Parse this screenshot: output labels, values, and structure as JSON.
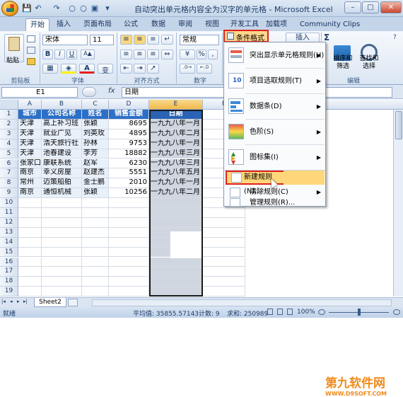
{
  "window": {
    "title": "自动突出单元格内容全为汉字的单元格 - Microsoft Excel"
  },
  "quick_access": {
    "save": "💾",
    "undo": "↶",
    "redo": "↷",
    "circle1": "○",
    "circle2": "○",
    "print": "▣",
    "more": "▾"
  },
  "window_controls": {
    "minimize": "–",
    "maximize": "□",
    "close": "✕"
  },
  "tabs": [
    "开始",
    "插入",
    "页面布局",
    "公式",
    "数据",
    "审阅",
    "视图",
    "开发工具",
    "加载项",
    "Community Clips"
  ],
  "ribbon": {
    "paste_label": "粘贴",
    "clipboard_group": "剪贴板",
    "font_name": "宋体",
    "font_size": "11",
    "font_group": "字体",
    "bold": "B",
    "italic": "I",
    "underline": "U",
    "font_color_letter": "A",
    "wen": "变",
    "align_group": "对齐方式",
    "number_format": "常规",
    "percent": "%",
    "comma": ",",
    "number_group": "数字",
    "conditional_format": "条件格式",
    "insert_label": "插入",
    "sigma": "Σ",
    "sort_filter": "排序和\n筛选",
    "find_select": "查找和\n选择",
    "edit_group": "编辑"
  },
  "formula_bar": {
    "name_box": "E1",
    "fx": "fx",
    "content": "日期"
  },
  "columns": [
    "A",
    "B",
    "C",
    "D",
    "E",
    "F"
  ],
  "rows": [
    "1",
    "2",
    "3",
    "4",
    "5",
    "6",
    "7",
    "8",
    "9",
    "10",
    "11",
    "12",
    "13",
    "14",
    "15",
    "16",
    "17",
    "18",
    "19"
  ],
  "table": {
    "headers": [
      "城市",
      "公司名称",
      "姓名",
      "销售金额",
      "日期"
    ],
    "rows": [
      [
        "天津",
        "高上补习班",
        "张颖",
        "8695",
        "一九九八年一月"
      ],
      [
        "天津",
        "就业广见",
        "刘英玫",
        "4895",
        "一九九八年二月"
      ],
      [
        "天津",
        "浩天旅行社",
        "孙林",
        "9753",
        "一九九八年一月"
      ],
      [
        "天津",
        "池春建设",
        "李芳",
        "18882",
        "一九九八年三月"
      ],
      [
        "张家口",
        "康联系统",
        "赵军",
        "6230",
        "一九九八年三月"
      ],
      [
        "南京",
        "幸义房屋",
        "赵建杰",
        "5551",
        "一九九八年五月"
      ],
      [
        "常州",
        "迈策船舶",
        "金士鹏",
        "2010",
        "一九九八年一月"
      ],
      [
        "南京",
        "通恒机械",
        "张颖",
        "10256",
        "一九九八年二月"
      ]
    ]
  },
  "cf_menu": {
    "items": [
      {
        "label": "突出显示单元格规则(H)",
        "icon": "highlight-rules-icon"
      },
      {
        "label": "项目选取规则(T)",
        "icon": "top-bottom-rules-icon"
      },
      {
        "label": "数据条(D)",
        "icon": "data-bars-icon"
      },
      {
        "label": "色阶(S)",
        "icon": "color-scales-icon"
      },
      {
        "label": "图标集(I)",
        "icon": "icon-sets-icon"
      }
    ],
    "small_items": [
      {
        "label": "新建规则(N)...",
        "icon": "new-rule-icon"
      },
      {
        "label": "清除规则(C)",
        "icon": "clear-rules-icon"
      },
      {
        "label": "管理规则(R)...",
        "icon": "manage-rules-icon"
      }
    ],
    "submenu_arrow": "▶",
    "top10_text": "10"
  },
  "sheet": {
    "tab": "Sheet2",
    "nav": [
      "|◂",
      "◂",
      "▸",
      "▸|"
    ]
  },
  "status": {
    "mode": "就绪",
    "average": "平均值: 35855.57143",
    "count": "计数: 9",
    "sum": "求和: 250989",
    "zoom": "100%"
  },
  "watermark": {
    "main": "第九软件网",
    "sub": "WWW.D9SOFT.COM"
  },
  "colors": {
    "header_blue": "#2c6fc7",
    "highlight_red": "#e0201b",
    "menu_hover": "#ffd77a"
  }
}
